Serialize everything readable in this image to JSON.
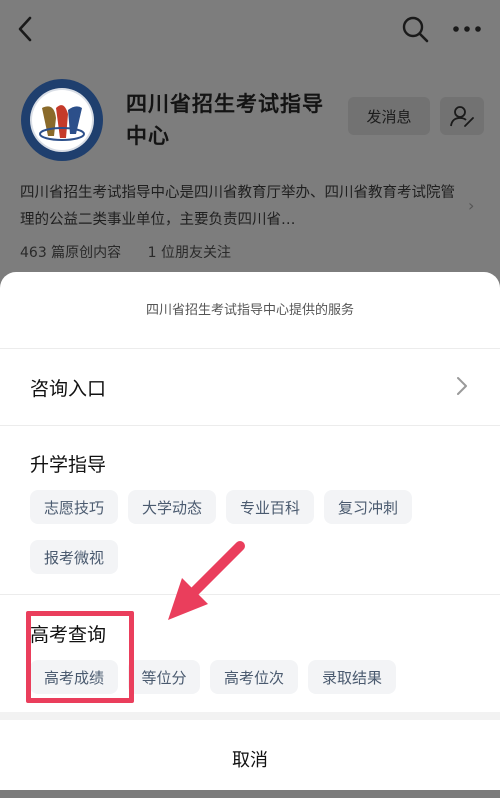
{
  "header": {
    "back_icon": "chevron-left-icon",
    "search_icon": "search-icon",
    "more_icon": "more-dots-icon"
  },
  "account": {
    "name": "四川省招生考试指导中心",
    "message_button": "发消息",
    "follow_icon": "user-settings-icon",
    "description": "四川省招生考试指导中心是四川省教育厅举办、四川省教育考试院管理的公益二类事业单位，主要负责四川省…",
    "stats": {
      "original_count": "463 篇原创内容",
      "friends_following": "1 位朋友关注"
    }
  },
  "sheet": {
    "title": "四川省招生考试指导中心提供的服务",
    "consult": {
      "label": "咨询入口"
    },
    "section_guide": {
      "title": "升学指导",
      "items": [
        "志愿技巧",
        "大学动态",
        "专业百科",
        "复习冲刺",
        "报考微视"
      ]
    },
    "section_query": {
      "title": "高考查询",
      "items": [
        "高考成绩",
        "等位分",
        "高考位次",
        "录取结果"
      ]
    },
    "cancel_label": "取消"
  },
  "colors": {
    "overlay_bg": "#7d7d7d",
    "highlight": "#ea3e5c",
    "chip_bg": "#f3f4f6",
    "chip_text": "#4a5a6f"
  }
}
